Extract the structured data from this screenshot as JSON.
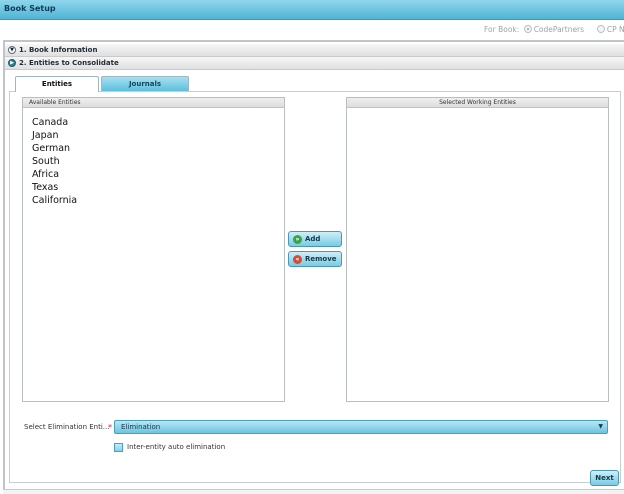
{
  "window": {
    "title": "Book Setup"
  },
  "for_book": {
    "label": "For Book:",
    "options": [
      {
        "label": "CodePartners",
        "selected": true
      },
      {
        "label": "CP New",
        "selected": false
      }
    ]
  },
  "accordion": {
    "sections": [
      {
        "label": "1. Book Information",
        "expanded": false
      },
      {
        "label": "2. Entities to Consolidate",
        "expanded": true
      }
    ]
  },
  "tabs": [
    {
      "label": "Entities",
      "active": true
    },
    {
      "label": "Journals",
      "active": false
    }
  ],
  "available_entities": {
    "header": "Available Entities",
    "items": [
      "Canada",
      "Japan",
      "German",
      "South",
      "Africa",
      "Texas",
      "California"
    ]
  },
  "selected_entities": {
    "header": "Selected Working Entities",
    "items": []
  },
  "actions": {
    "add_label": "Add",
    "remove_label": "Remove"
  },
  "elimination": {
    "label": "Select Elimination Enti...",
    "required_marker": "*",
    "selected_value": "Elimination",
    "auto_elimination_label": "Inter-entity auto elimination",
    "auto_elimination_checked": false
  },
  "footer": {
    "next_label": "Next"
  },
  "icons": {
    "section_collapsed": "chevron-down-icon",
    "section_expanded": "chevron-right-icon",
    "add": "plus-circle-icon",
    "remove": "x-circle-icon",
    "dropdown": "caret-down-icon"
  },
  "colors": {
    "accent": "#5cc0de",
    "required": "#dd2222",
    "add_icon": "#39a447",
    "remove_icon": "#d64a3a"
  }
}
